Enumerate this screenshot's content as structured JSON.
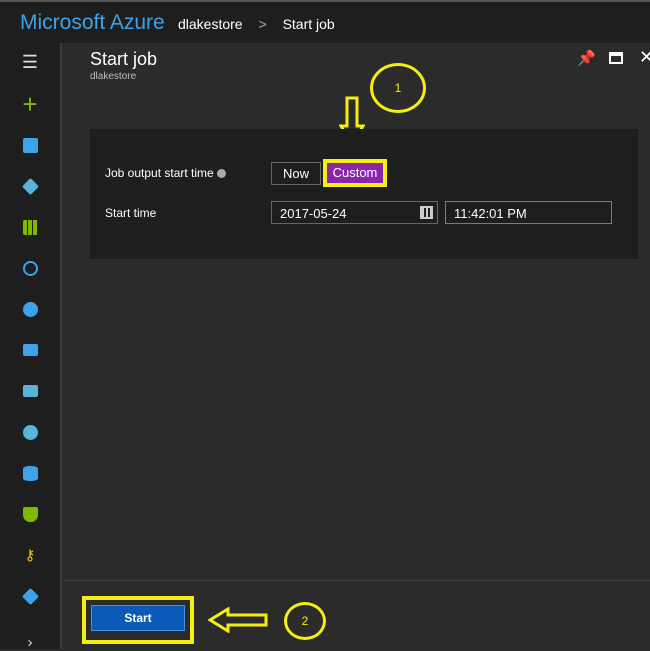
{
  "topbar": {
    "brand": "Microsoft Azure",
    "breadcrumb": [
      "dlakestore",
      "Start job"
    ]
  },
  "panel": {
    "title": "Start job",
    "subtitle": "dlakestore"
  },
  "form": {
    "output_label": "Job output start time",
    "now_label": "Now",
    "custom_label": "Custom",
    "start_time_label": "Start time",
    "date_value": "2017-05-24",
    "time_value": "11:42:01 PM"
  },
  "footer": {
    "start_label": "Start"
  },
  "annotations": {
    "step1": "1",
    "step2": "2"
  },
  "colors": {
    "accent": "#3ea2e8",
    "custom": "#8b26a8",
    "highlight": "#f4ee12",
    "start": "#0a5ab8"
  }
}
